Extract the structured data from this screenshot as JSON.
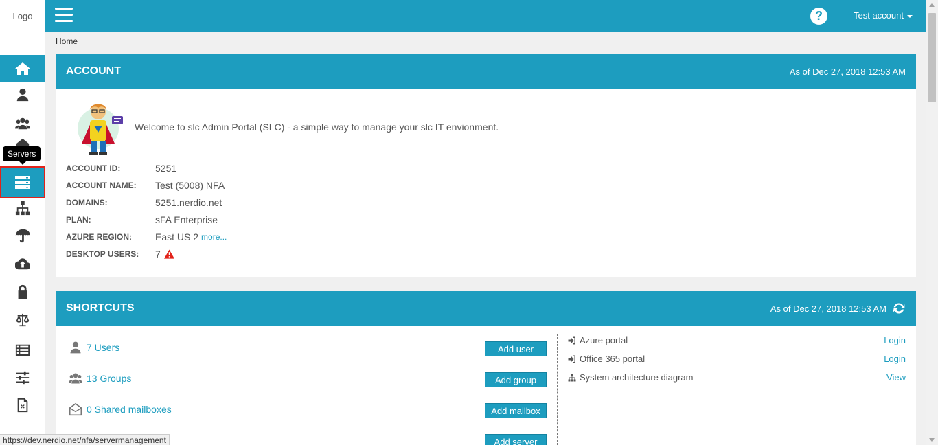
{
  "app": {
    "logo_text": "Logo",
    "account_menu_label": "Test account",
    "help_glyph": "?"
  },
  "sidebar": {
    "items": [
      {
        "name": "home-icon",
        "active": false
      },
      {
        "name": "user-icon"
      },
      {
        "name": "users-icon"
      },
      {
        "name": "mailbox-icon"
      },
      {
        "name": "servers-icon",
        "tooltip": "Servers",
        "active": true
      },
      {
        "name": "sitemap-icon"
      },
      {
        "name": "umbrella-icon"
      },
      {
        "name": "cloud-upload-icon"
      },
      {
        "name": "lock-icon"
      },
      {
        "name": "balance-scale-icon"
      },
      {
        "name": "list-icon"
      },
      {
        "name": "sliders-icon"
      },
      {
        "name": "code-file-icon"
      }
    ],
    "tooltip": "Servers"
  },
  "breadcrumb": "Home",
  "account_panel": {
    "title": "ACCOUNT",
    "as_of": "As of Dec 27, 2018 12:53 AM",
    "welcome": "Welcome to slc Admin Portal (SLC) - a simple way to manage your slc IT envionment.",
    "fields": [
      {
        "label": "ACCOUNT ID:",
        "value": "5251"
      },
      {
        "label": "ACCOUNT NAME:",
        "value": "Test (5008) NFA"
      },
      {
        "label": "DOMAINS:",
        "value": "5251.nerdio.net"
      },
      {
        "label": "PLAN:",
        "value": "sFA Enterprise"
      },
      {
        "label": "AZURE REGION:",
        "value": "East US 2",
        "link": "more..."
      },
      {
        "label": "DESKTOP USERS:",
        "value": "7"
      }
    ]
  },
  "shortcuts_panel": {
    "title": "SHORTCUTS",
    "as_of": "As of Dec 27, 2018 12:53 AM",
    "items": [
      {
        "link": "7 Users",
        "button": "Add user",
        "icon": "user-icon"
      },
      {
        "link": "13 Groups",
        "button": "Add group",
        "icon": "users-icon"
      },
      {
        "link": "0 Shared mailboxes",
        "button": "Add mailbox",
        "icon": "envelope-open-icon"
      },
      {
        "link": "",
        "button": "Add server",
        "icon": ""
      }
    ],
    "links": [
      {
        "label": "Azure portal",
        "action": "Login",
        "icon": "sign-in-icon"
      },
      {
        "label": "Office 365 portal",
        "action": "Login",
        "icon": "sign-in-icon"
      },
      {
        "label": "System architecture diagram",
        "action": "View",
        "icon": "sitemap-icon"
      }
    ]
  },
  "statusbar": {
    "url": "https://dev.nerdio.net/nfa/servermanagement"
  },
  "colors": {
    "primary": "#1d9dbf",
    "highlight_border": "#e2231a",
    "warning": "#e2231a"
  }
}
